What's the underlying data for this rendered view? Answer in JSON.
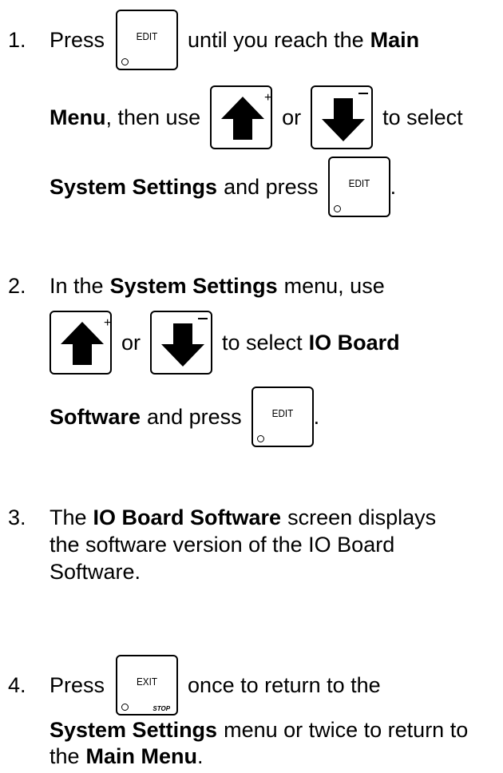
{
  "steps": [
    {
      "number": "1.",
      "line1": {
        "a": "Press",
        "b": "until you reach the",
        "c": "Main"
      },
      "line2": {
        "a": "Menu",
        "b": ", then use",
        "c": "or",
        "d": "to select"
      },
      "line3": {
        "a": "System Settings",
        "b": "and press",
        "c": "."
      }
    },
    {
      "number": "2.",
      "line1": {
        "a": "In the",
        "b": "System Settings",
        "c": "menu, use"
      },
      "line2": {
        "a": "or",
        "b": "to select",
        "c": "IO Board"
      },
      "line3": {
        "a": "Software",
        "b": "and press",
        "c": "."
      }
    },
    {
      "number": "3.",
      "line1": {
        "a": "The",
        "b": "IO Board Software",
        "c": "screen displays"
      },
      "line2": {
        "a": "the software version of the IO Board"
      },
      "line3": {
        "a": "Software."
      }
    },
    {
      "number": "4.",
      "line1": {
        "a": "Press",
        "b": "once to return to the"
      },
      "line2": {
        "a": "System Settings",
        "b": "menu or twice to return to"
      },
      "line3": {
        "a": "the",
        "b": "Main Menu",
        "c": "."
      }
    }
  ],
  "keys": {
    "edit_label": "EDIT",
    "exit_label": "EXIT",
    "stop_label": "STOP",
    "plus": "+",
    "minus": "−"
  }
}
